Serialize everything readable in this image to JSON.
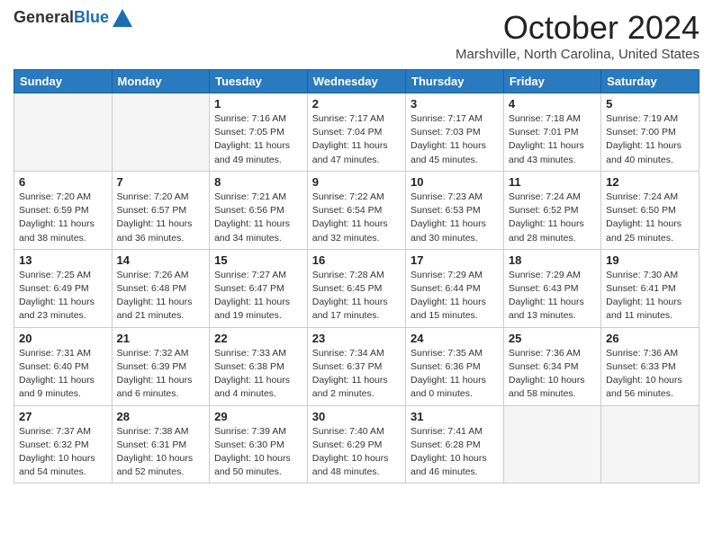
{
  "header": {
    "logo_general": "General",
    "logo_blue": "Blue",
    "month_title": "October 2024",
    "location": "Marshville, North Carolina, United States"
  },
  "weekdays": [
    "Sunday",
    "Monday",
    "Tuesday",
    "Wednesday",
    "Thursday",
    "Friday",
    "Saturday"
  ],
  "weeks": [
    [
      {
        "day": "",
        "sunrise": "",
        "sunset": "",
        "daylight": ""
      },
      {
        "day": "",
        "sunrise": "",
        "sunset": "",
        "daylight": ""
      },
      {
        "day": "1",
        "sunrise": "Sunrise: 7:16 AM",
        "sunset": "Sunset: 7:05 PM",
        "daylight": "Daylight: 11 hours and 49 minutes."
      },
      {
        "day": "2",
        "sunrise": "Sunrise: 7:17 AM",
        "sunset": "Sunset: 7:04 PM",
        "daylight": "Daylight: 11 hours and 47 minutes."
      },
      {
        "day": "3",
        "sunrise": "Sunrise: 7:17 AM",
        "sunset": "Sunset: 7:03 PM",
        "daylight": "Daylight: 11 hours and 45 minutes."
      },
      {
        "day": "4",
        "sunrise": "Sunrise: 7:18 AM",
        "sunset": "Sunset: 7:01 PM",
        "daylight": "Daylight: 11 hours and 43 minutes."
      },
      {
        "day": "5",
        "sunrise": "Sunrise: 7:19 AM",
        "sunset": "Sunset: 7:00 PM",
        "daylight": "Daylight: 11 hours and 40 minutes."
      }
    ],
    [
      {
        "day": "6",
        "sunrise": "Sunrise: 7:20 AM",
        "sunset": "Sunset: 6:59 PM",
        "daylight": "Daylight: 11 hours and 38 minutes."
      },
      {
        "day": "7",
        "sunrise": "Sunrise: 7:20 AM",
        "sunset": "Sunset: 6:57 PM",
        "daylight": "Daylight: 11 hours and 36 minutes."
      },
      {
        "day": "8",
        "sunrise": "Sunrise: 7:21 AM",
        "sunset": "Sunset: 6:56 PM",
        "daylight": "Daylight: 11 hours and 34 minutes."
      },
      {
        "day": "9",
        "sunrise": "Sunrise: 7:22 AM",
        "sunset": "Sunset: 6:54 PM",
        "daylight": "Daylight: 11 hours and 32 minutes."
      },
      {
        "day": "10",
        "sunrise": "Sunrise: 7:23 AM",
        "sunset": "Sunset: 6:53 PM",
        "daylight": "Daylight: 11 hours and 30 minutes."
      },
      {
        "day": "11",
        "sunrise": "Sunrise: 7:24 AM",
        "sunset": "Sunset: 6:52 PM",
        "daylight": "Daylight: 11 hours and 28 minutes."
      },
      {
        "day": "12",
        "sunrise": "Sunrise: 7:24 AM",
        "sunset": "Sunset: 6:50 PM",
        "daylight": "Daylight: 11 hours and 25 minutes."
      }
    ],
    [
      {
        "day": "13",
        "sunrise": "Sunrise: 7:25 AM",
        "sunset": "Sunset: 6:49 PM",
        "daylight": "Daylight: 11 hours and 23 minutes."
      },
      {
        "day": "14",
        "sunrise": "Sunrise: 7:26 AM",
        "sunset": "Sunset: 6:48 PM",
        "daylight": "Daylight: 11 hours and 21 minutes."
      },
      {
        "day": "15",
        "sunrise": "Sunrise: 7:27 AM",
        "sunset": "Sunset: 6:47 PM",
        "daylight": "Daylight: 11 hours and 19 minutes."
      },
      {
        "day": "16",
        "sunrise": "Sunrise: 7:28 AM",
        "sunset": "Sunset: 6:45 PM",
        "daylight": "Daylight: 11 hours and 17 minutes."
      },
      {
        "day": "17",
        "sunrise": "Sunrise: 7:29 AM",
        "sunset": "Sunset: 6:44 PM",
        "daylight": "Daylight: 11 hours and 15 minutes."
      },
      {
        "day": "18",
        "sunrise": "Sunrise: 7:29 AM",
        "sunset": "Sunset: 6:43 PM",
        "daylight": "Daylight: 11 hours and 13 minutes."
      },
      {
        "day": "19",
        "sunrise": "Sunrise: 7:30 AM",
        "sunset": "Sunset: 6:41 PM",
        "daylight": "Daylight: 11 hours and 11 minutes."
      }
    ],
    [
      {
        "day": "20",
        "sunrise": "Sunrise: 7:31 AM",
        "sunset": "Sunset: 6:40 PM",
        "daylight": "Daylight: 11 hours and 9 minutes."
      },
      {
        "day": "21",
        "sunrise": "Sunrise: 7:32 AM",
        "sunset": "Sunset: 6:39 PM",
        "daylight": "Daylight: 11 hours and 6 minutes."
      },
      {
        "day": "22",
        "sunrise": "Sunrise: 7:33 AM",
        "sunset": "Sunset: 6:38 PM",
        "daylight": "Daylight: 11 hours and 4 minutes."
      },
      {
        "day": "23",
        "sunrise": "Sunrise: 7:34 AM",
        "sunset": "Sunset: 6:37 PM",
        "daylight": "Daylight: 11 hours and 2 minutes."
      },
      {
        "day": "24",
        "sunrise": "Sunrise: 7:35 AM",
        "sunset": "Sunset: 6:36 PM",
        "daylight": "Daylight: 11 hours and 0 minutes."
      },
      {
        "day": "25",
        "sunrise": "Sunrise: 7:36 AM",
        "sunset": "Sunset: 6:34 PM",
        "daylight": "Daylight: 10 hours and 58 minutes."
      },
      {
        "day": "26",
        "sunrise": "Sunrise: 7:36 AM",
        "sunset": "Sunset: 6:33 PM",
        "daylight": "Daylight: 10 hours and 56 minutes."
      }
    ],
    [
      {
        "day": "27",
        "sunrise": "Sunrise: 7:37 AM",
        "sunset": "Sunset: 6:32 PM",
        "daylight": "Daylight: 10 hours and 54 minutes."
      },
      {
        "day": "28",
        "sunrise": "Sunrise: 7:38 AM",
        "sunset": "Sunset: 6:31 PM",
        "daylight": "Daylight: 10 hours and 52 minutes."
      },
      {
        "day": "29",
        "sunrise": "Sunrise: 7:39 AM",
        "sunset": "Sunset: 6:30 PM",
        "daylight": "Daylight: 10 hours and 50 minutes."
      },
      {
        "day": "30",
        "sunrise": "Sunrise: 7:40 AM",
        "sunset": "Sunset: 6:29 PM",
        "daylight": "Daylight: 10 hours and 48 minutes."
      },
      {
        "day": "31",
        "sunrise": "Sunrise: 7:41 AM",
        "sunset": "Sunset: 6:28 PM",
        "daylight": "Daylight: 10 hours and 46 minutes."
      },
      {
        "day": "",
        "sunrise": "",
        "sunset": "",
        "daylight": ""
      },
      {
        "day": "",
        "sunrise": "",
        "sunset": "",
        "daylight": ""
      }
    ]
  ]
}
